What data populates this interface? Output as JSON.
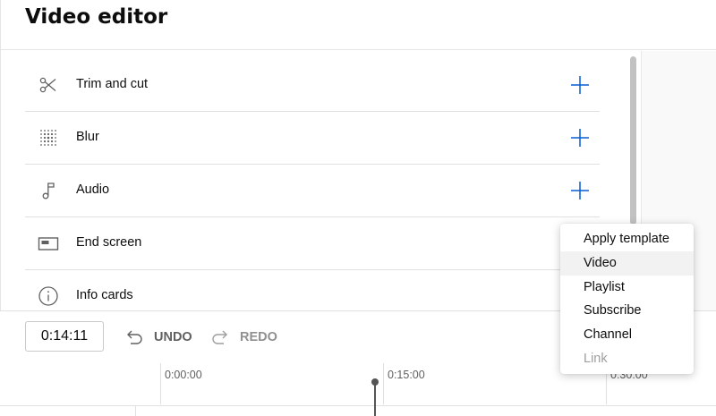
{
  "header": {
    "title": "Video editor"
  },
  "tools": [
    {
      "label": "Trim and cut",
      "icon": "scissors-icon",
      "has_add": true
    },
    {
      "label": "Blur",
      "icon": "blur-grid-icon",
      "has_add": true
    },
    {
      "label": "Audio",
      "icon": "music-note-icon",
      "has_add": true
    },
    {
      "label": "End screen",
      "icon": "end-screen-icon",
      "has_add": false
    },
    {
      "label": "Info cards",
      "icon": "info-icon",
      "has_add": false
    }
  ],
  "add_icon": "plus-icon",
  "accent_color": "#065fd4",
  "controls": {
    "time": "0:14:11",
    "undo_label": "UNDO",
    "redo_label": "REDO",
    "undo_icon": "undo-arrow-icon",
    "redo_icon": "redo-arrow-icon"
  },
  "timeline": {
    "ticks": [
      "0:00:00",
      "0:15:00",
      "0:30:00"
    ]
  },
  "dropdown": {
    "items": [
      {
        "label": "Apply template",
        "state": "normal"
      },
      {
        "label": "Video",
        "state": "hovered"
      },
      {
        "label": "Playlist",
        "state": "normal"
      },
      {
        "label": "Subscribe",
        "state": "normal"
      },
      {
        "label": "Channel",
        "state": "normal"
      },
      {
        "label": "Link",
        "state": "disabled"
      }
    ]
  }
}
